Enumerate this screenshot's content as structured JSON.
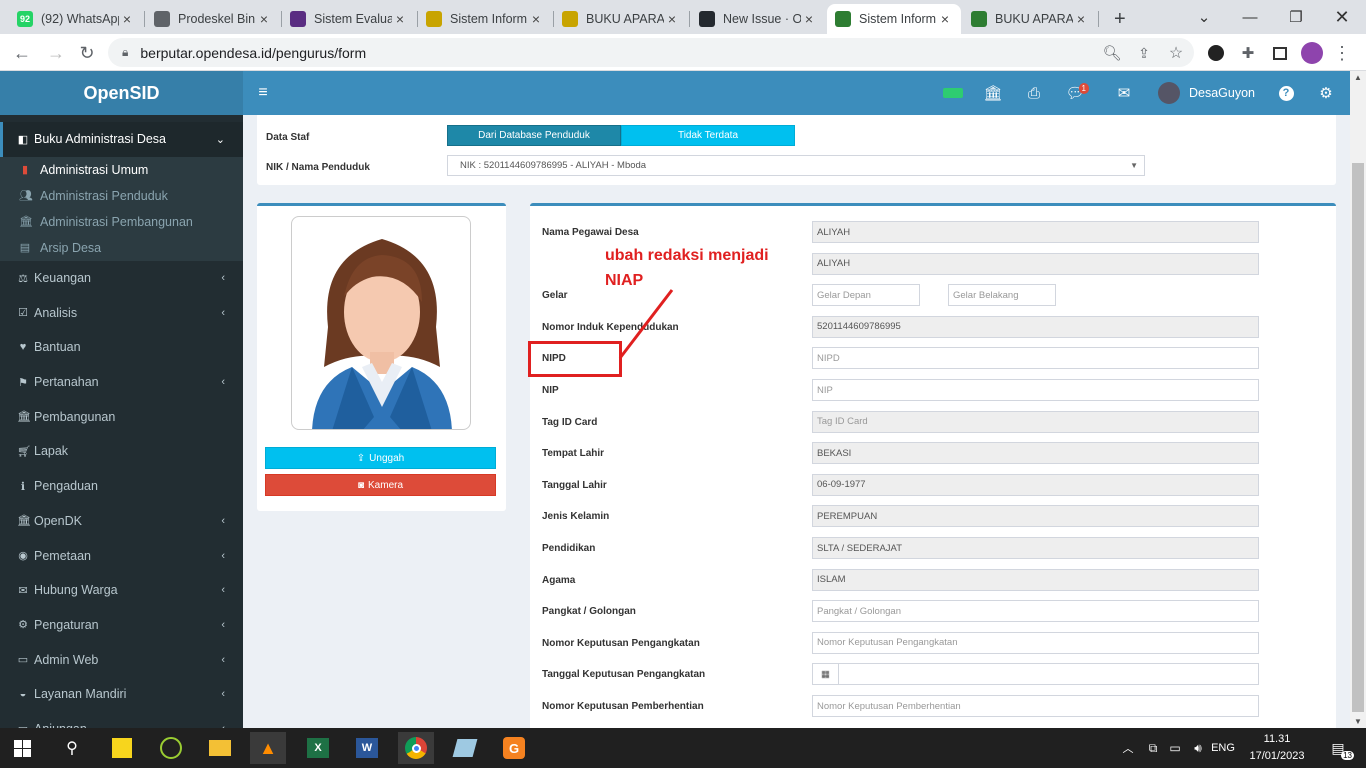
{
  "browser": {
    "tabs": [
      {
        "title": "(92) WhatsApp",
        "fav_color": "#25d366",
        "fav_text": "92"
      },
      {
        "title": "Prodeskel Bin",
        "fav_color": "#5f6368",
        "fav_text": ""
      },
      {
        "title": "Sistem Evalua",
        "fav_color": "#5a2d82",
        "fav_text": ""
      },
      {
        "title": "Sistem Inform",
        "fav_color": "#c8a400",
        "fav_text": ""
      },
      {
        "title": "BUKU APARA",
        "fav_color": "#c8a400",
        "fav_text": ""
      },
      {
        "title": "New Issue · O",
        "fav_color": "#24292f",
        "fav_text": ""
      },
      {
        "title": "Sistem Inform",
        "fav_color": "#2e7d32",
        "fav_text": ""
      },
      {
        "title": "BUKU APARA",
        "fav_color": "#2e7d32",
        "fav_text": ""
      }
    ],
    "close_glyph": "×",
    "new_tab": "+",
    "url": "berputar.opendesa.id/pengurus/form"
  },
  "app": {
    "logo": "OpenSID",
    "username": "DesaGuyon",
    "notif_count": "1"
  },
  "sidebar": {
    "active": "Buku Administrasi Desa",
    "sub": [
      "Administrasi Umum",
      "Administrasi Penduduk",
      "Administrasi Pembangunan",
      "Arsip Desa"
    ],
    "items": [
      {
        "label": "Keuangan",
        "chev": "‹"
      },
      {
        "label": "Analisis",
        "chev": "‹"
      },
      {
        "label": "Bantuan",
        "chev": ""
      },
      {
        "label": "Pertanahan",
        "chev": "‹"
      },
      {
        "label": "Pembangunan",
        "chev": ""
      },
      {
        "label": "Lapak",
        "chev": ""
      },
      {
        "label": "Pengaduan",
        "chev": ""
      },
      {
        "label": "OpenDK",
        "chev": "‹"
      },
      {
        "label": "Pemetaan",
        "chev": "‹"
      },
      {
        "label": "Hubung Warga",
        "chev": "‹"
      },
      {
        "label": "Pengaturan",
        "chev": "‹"
      },
      {
        "label": "Admin Web",
        "chev": "‹"
      },
      {
        "label": "Layanan Mandiri",
        "chev": "‹"
      },
      {
        "label": "Anjungan",
        "chev": "‹"
      }
    ]
  },
  "form_top": {
    "data_staf_label": "Data Staf",
    "btn_db": "Dari Database Penduduk",
    "btn_tidak": "Tidak Terdata",
    "nik_label": "NIK / Nama Penduduk",
    "nik_value": "NIK : 5201144609786995 - ALIYAH - Mboda"
  },
  "photo": {
    "upload": "Unggah",
    "camera": "Kamera"
  },
  "fields": [
    {
      "label": "Nama Pegawai Desa",
      "value": "ALIYAH",
      "placeholder": "",
      "ro": true
    },
    {
      "label": "",
      "value": "ALIYAH",
      "placeholder": "",
      "ro": true
    },
    {
      "label": "Gelar",
      "value": "",
      "placeholder": "",
      "ro": false
    },
    {
      "label": "Nomor Induk Kependudukan",
      "value": "5201144609786995",
      "placeholder": "",
      "ro": true
    },
    {
      "label": "NIPD",
      "value": "",
      "placeholder": "NIPD",
      "ro": false
    },
    {
      "label": "NIP",
      "value": "",
      "placeholder": "NIP",
      "ro": false
    },
    {
      "label": "Tag ID Card",
      "value": "",
      "placeholder": "Tag ID Card",
      "ro": true
    },
    {
      "label": "Tempat Lahir",
      "value": "BEKASI",
      "placeholder": "",
      "ro": true
    },
    {
      "label": "Tanggal Lahir",
      "value": "06-09-1977",
      "placeholder": "",
      "ro": true
    },
    {
      "label": "Jenis Kelamin",
      "value": "PEREMPUAN",
      "placeholder": "",
      "ro": true
    },
    {
      "label": "Pendidikan",
      "value": "SLTA / SEDERAJAT",
      "placeholder": "",
      "ro": true
    },
    {
      "label": "Agama",
      "value": "ISLAM",
      "placeholder": "",
      "ro": true
    },
    {
      "label": "Pangkat / Golongan",
      "value": "",
      "placeholder": "Pangkat / Golongan",
      "ro": false
    },
    {
      "label": "Nomor Keputusan Pengangkatan",
      "value": "",
      "placeholder": "Nomor Keputusan Pengangkatan",
      "ro": false
    },
    {
      "label": "Tanggal Keputusan Pengangkatan",
      "value": "",
      "placeholder": "",
      "ro": false
    },
    {
      "label": "Nomor Keputusan Pemberhentian",
      "value": "",
      "placeholder": "Nomor Keputusan Pemberhentian",
      "ro": false
    }
  ],
  "gelar": {
    "depan": "Gelar Depan",
    "belakang": "Gelar Belakang"
  },
  "annotation": {
    "line1": "ubah redaksi menjadi",
    "line2": "NIAP",
    "color": "#e02020"
  },
  "taskbar": {
    "lang": "ENG",
    "time": "11.31",
    "date": "17/01/2023",
    "notif": "13"
  },
  "colors": {
    "sidebar": "#222d32",
    "header": "#3c8dbc",
    "logo": "#367fa9",
    "aqua": "#00c0ef",
    "danger": "#dd4b39"
  }
}
